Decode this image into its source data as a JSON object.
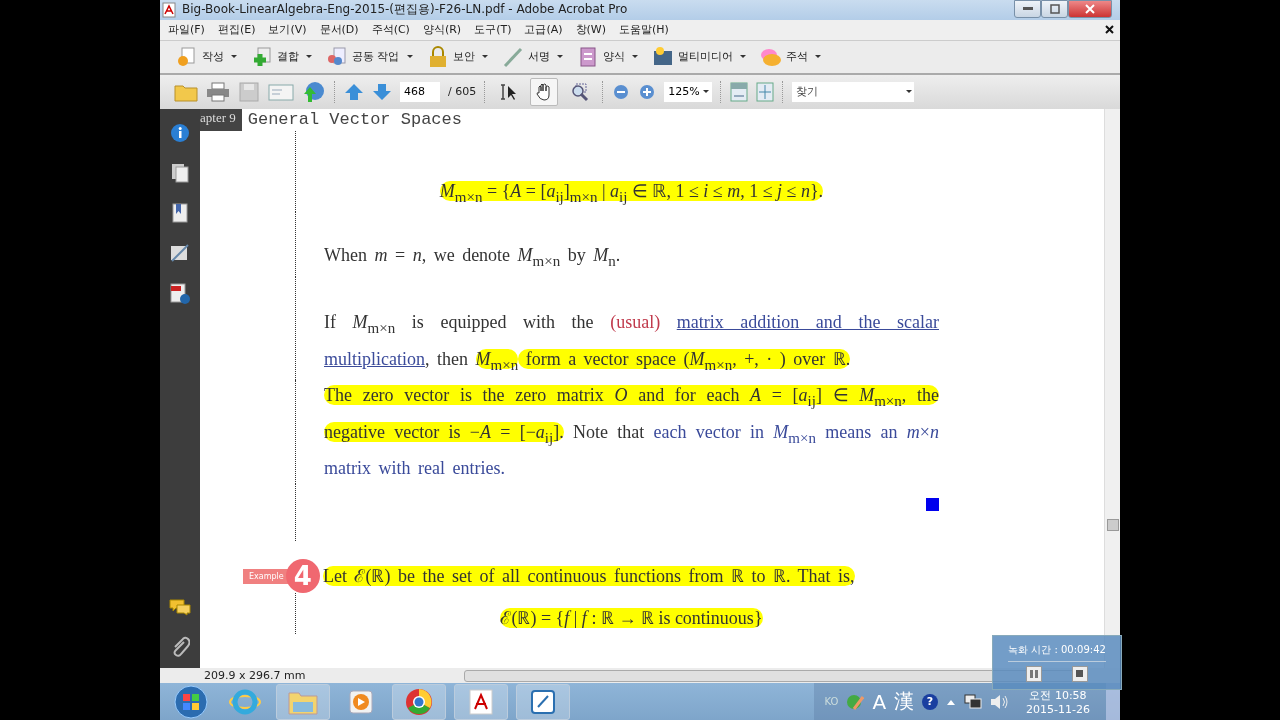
{
  "window": {
    "title": "Big-Book-LinearAlgebra-Eng-2015-(편집용)-F26-LN.pdf - Adobe Acrobat Pro"
  },
  "menu": [
    "파일(F)",
    "편집(E)",
    "보기(V)",
    "문서(D)",
    "주석(C)",
    "양식(R)",
    "도구(T)",
    "고급(A)",
    "창(W)",
    "도움말(H)"
  ],
  "task_toolbar": [
    {
      "kind": "create",
      "label": "작성"
    },
    {
      "kind": "combine",
      "label": "결합"
    },
    {
      "kind": "collaborate",
      "label": "공동 작업"
    },
    {
      "kind": "secure",
      "label": "보안"
    },
    {
      "kind": "sign",
      "label": "서명"
    },
    {
      "kind": "forms",
      "label": "양식"
    },
    {
      "kind": "multimedia",
      "label": "멀티미디어"
    },
    {
      "kind": "comment",
      "label": "주석"
    }
  ],
  "page_toolbar": {
    "page": "468",
    "page_count": "/ 605",
    "tools": [
      {
        "kind": "select",
        "selected": false
      },
      {
        "kind": "hand",
        "selected": true
      },
      {
        "kind": "marquee",
        "selected": false
      }
    ],
    "zoom": "125%",
    "find_placeholder": "찾기"
  },
  "document": {
    "chapter_tab": "apter 9",
    "chapter_title": "General Vector Spaces",
    "blocks": [
      {
        "kind": "formula",
        "segments": [
          {
            "kind": "plain",
            "text": "*M*$_{m×n}$ = {*A* = [*a*$_{ij}$]$_{m×n}$ | *a*$_{ij}$ ∈ ℝ, 1 ≤ *i* ≤ *m*, 1 ≤ *j* ≤ *n*}.",
            "highlight": true
          }
        ]
      },
      {
        "kind": "text",
        "segments": [
          {
            "kind": "plain",
            "text": "When *m* = *n*, we denote *M*$_{m×n}$ by *M*$_{n}$.",
            "highlight": false
          }
        ]
      },
      {
        "kind": "text",
        "segments": [
          {
            "kind": "plain",
            "text": "If *M*$_{m×n}$ is equipped with the ",
            "highlight": false
          },
          {
            "kind": "red",
            "text": "(usual) ",
            "highlight": false
          },
          {
            "kind": "link",
            "text": "matrix addition and the scalar multiplication",
            "highlight": false
          },
          {
            "kind": "plain",
            "text": ", then ",
            "highlight": false
          },
          {
            "kind": "plain",
            "text": "*M*$_{m×n}$",
            "highlight": true
          },
          {
            "kind": "plain",
            "text": " form a vector space (*M*$_{m×n}$, +, · ) over ℝ.",
            "highlight": true
          }
        ]
      },
      {
        "kind": "text",
        "segments": [
          {
            "kind": "plain",
            "text": "The zero vector is the zero matrix *O* and for each *A* = [*a*$_{ij}$] ∈ *M*$_{m×n}$, the negative vector is −*A* = [−*a*$_{ij}$].",
            "highlight": true
          },
          {
            "kind": "plain",
            "text": " Note that ",
            "highlight": false
          },
          {
            "kind": "blue",
            "text": "each vector in *M*$_{m×n}$ means an *m*×*n* matrix with real entries.",
            "highlight": false
          }
        ]
      },
      {
        "kind": "qed"
      },
      {
        "kind": "example",
        "label": "Example",
        "number": "4",
        "segments": [
          {
            "kind": "plain",
            "text": "Let ℰ(ℝ) be the set of all continuous functions from ℝ to ℝ. That is,",
            "highlight": true
          }
        ]
      },
      {
        "kind": "formula",
        "segments": [
          {
            "kind": "plain",
            "text": "ℰ(ℝ) = {*f* | *f* : ℝ → ℝ is continuous}",
            "highlight": true
          }
        ]
      }
    ]
  },
  "status_bar": {
    "page_size": "209.9 x 296.7 mm"
  },
  "recorder": {
    "label": "녹화 시간 : 00:09:42"
  },
  "taskbar": {
    "tray": [
      "KO",
      "A",
      "漢"
    ],
    "help": "?",
    "time": "오전 10:58",
    "date": "2015-11-26"
  }
}
